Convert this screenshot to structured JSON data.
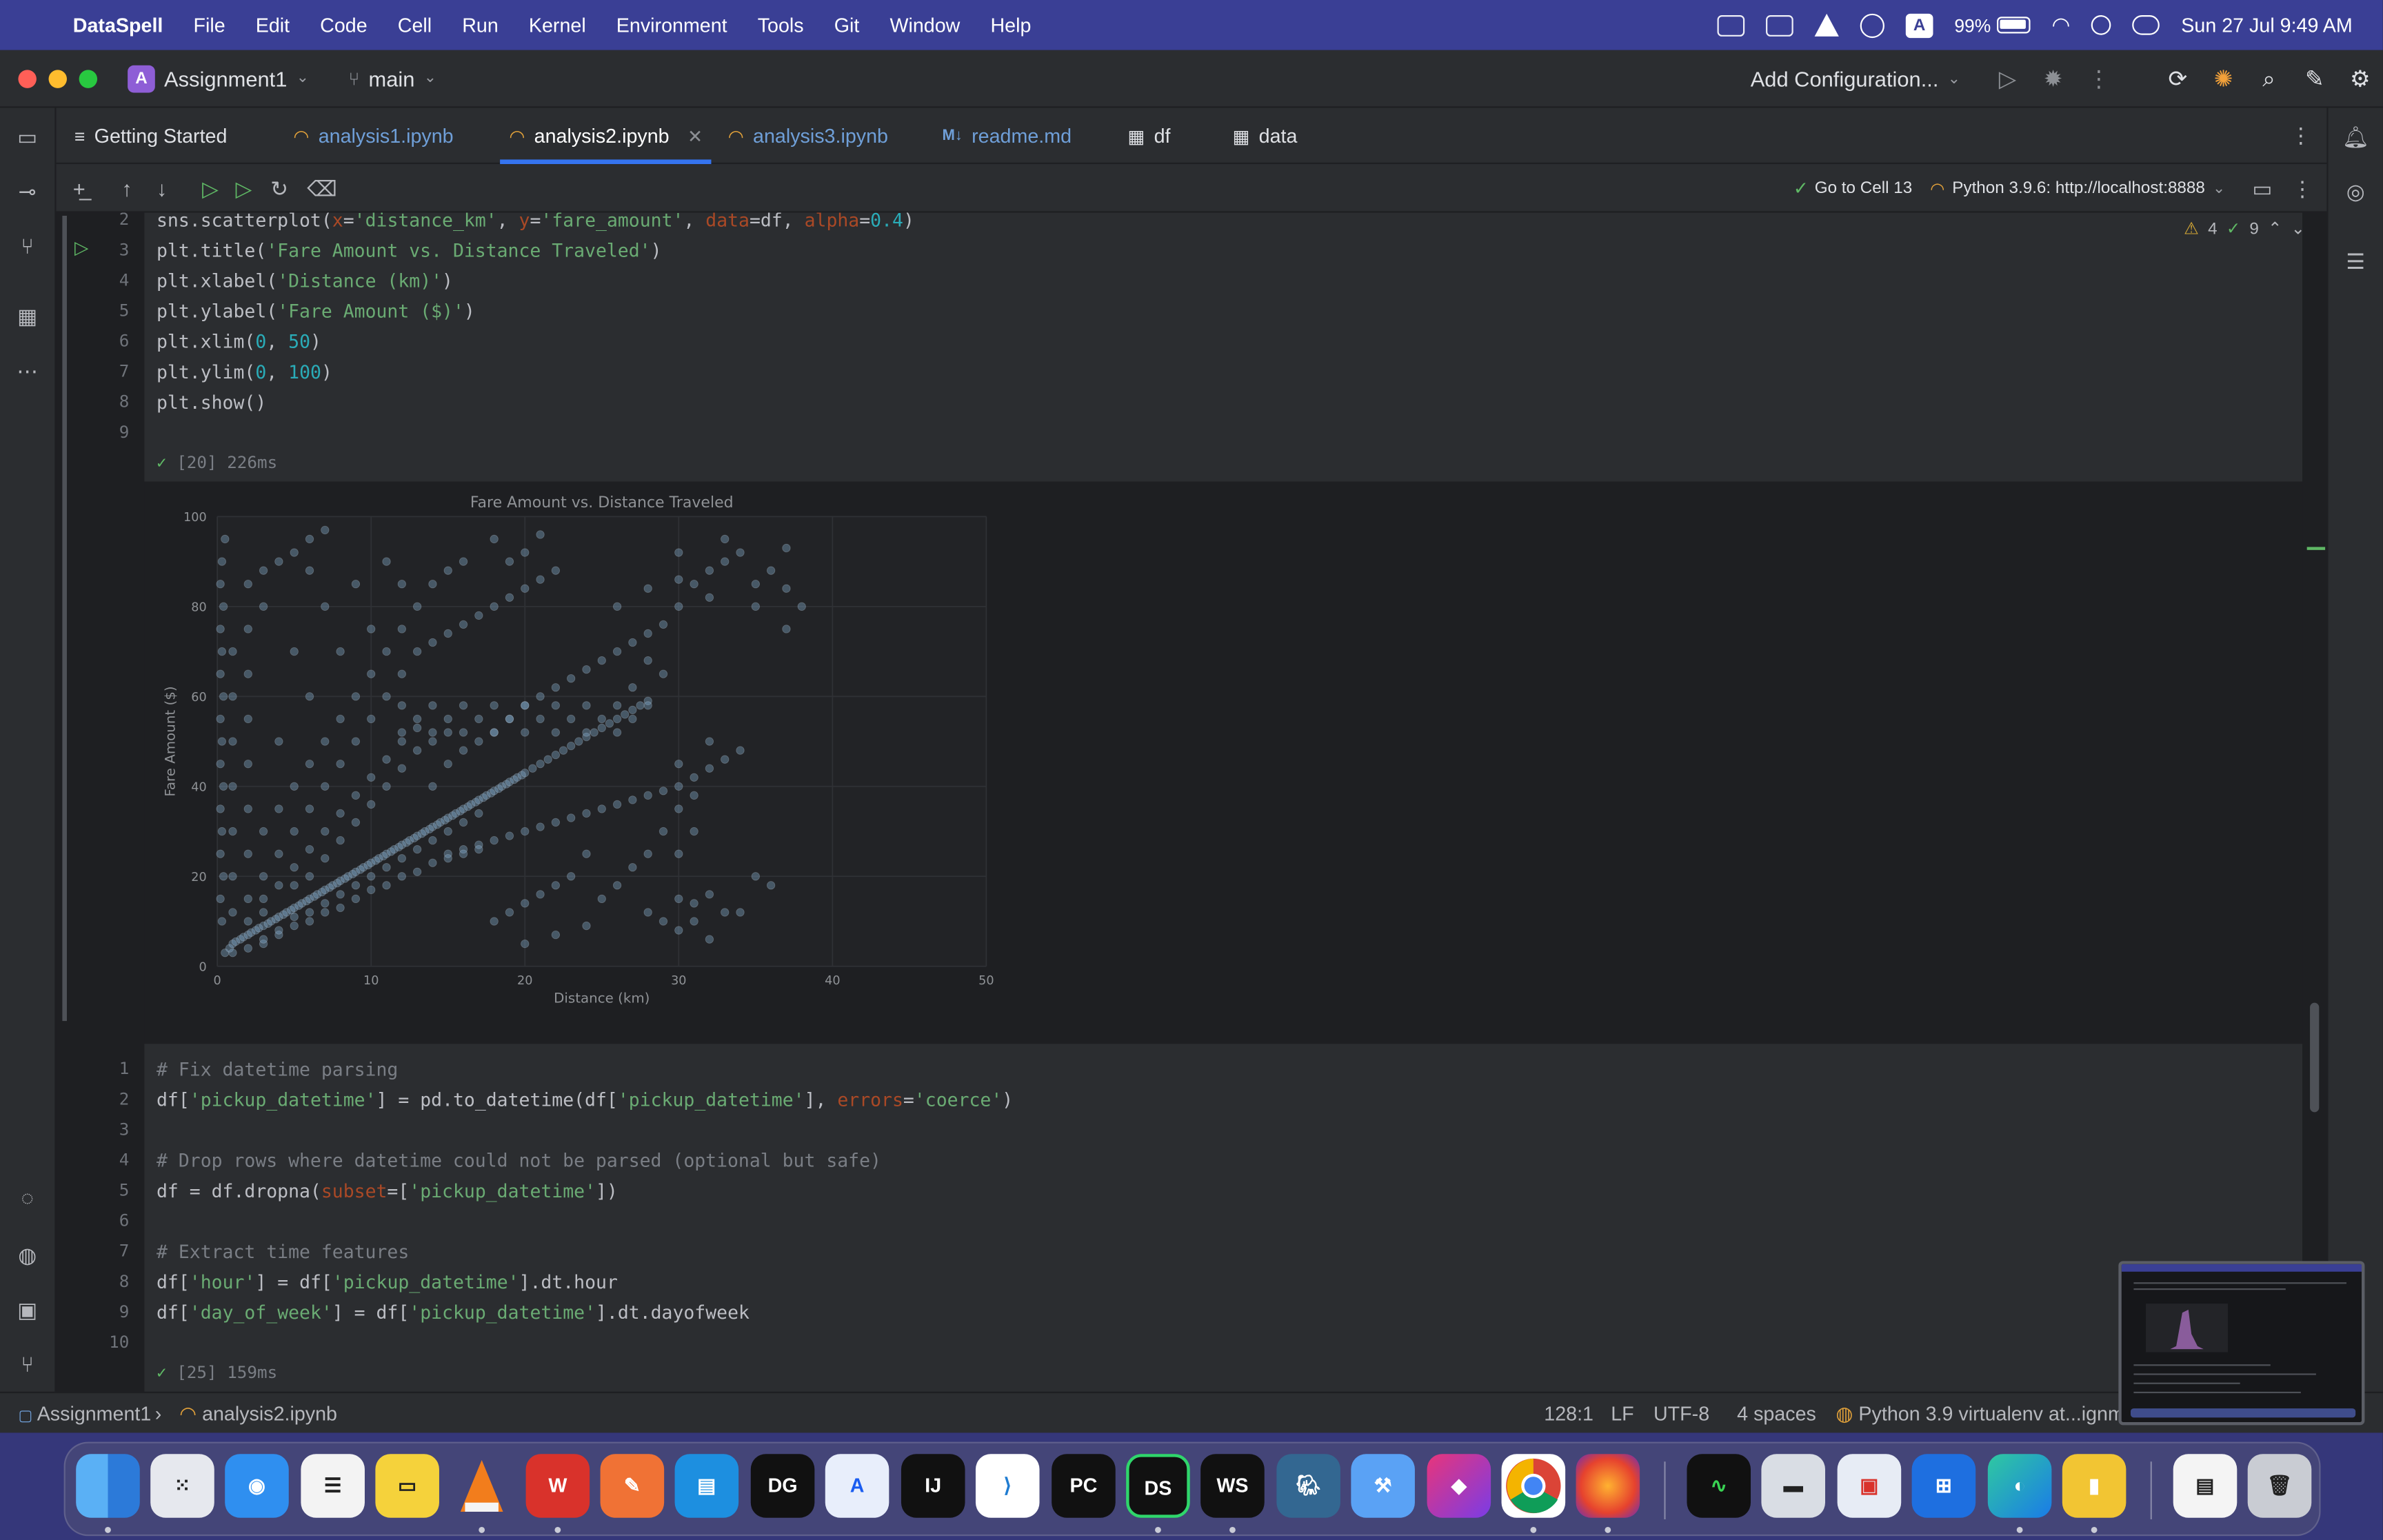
{
  "menubar": {
    "app": "DataSpell",
    "menus": [
      "File",
      "Edit",
      "Code",
      "Cell",
      "Run",
      "Kernel",
      "Environment",
      "Tools",
      "Git",
      "Window",
      "Help"
    ],
    "battery": "99%",
    "clock": "Sun 27 Jul  9:49 AM",
    "status_icons": [
      "display-icon",
      "w-icon",
      "vlc-icon",
      "play-icon",
      "a-icon",
      "battery-icon",
      "wifi-icon",
      "search-icon",
      "control-center-icon"
    ],
    "accent_color": "#3a3f95"
  },
  "titlebar": {
    "project_badge": "A",
    "project": "Assignment1",
    "branch": "main",
    "add_configuration": "Add Configuration..."
  },
  "tabs": [
    {
      "label": "Getting Started",
      "kind": "doc"
    },
    {
      "label": "analysis1.ipynb",
      "kind": "notebook"
    },
    {
      "label": "analysis2.ipynb",
      "kind": "notebook",
      "active": true
    },
    {
      "label": "analysis3.ipynb",
      "kind": "notebook"
    },
    {
      "label": "readme.md",
      "kind": "markdown",
      "icon": "M↓"
    },
    {
      "label": "df",
      "kind": "table"
    },
    {
      "label": "data",
      "kind": "table"
    }
  ],
  "toolbar": {
    "go_to_cell": "Go to Cell 13",
    "kernel": "Python 3.9.6: http://localhost:8888"
  },
  "inspections": {
    "warnings": "4",
    "ok": "9"
  },
  "cell1": {
    "lines": [
      {
        "num": "2"
      },
      {
        "num": "3"
      },
      {
        "num": "4"
      },
      {
        "num": "5"
      },
      {
        "num": "6"
      },
      {
        "num": "7"
      },
      {
        "num": "8"
      },
      {
        "num": "9"
      }
    ],
    "exec": "[20] 226ms"
  },
  "cell2": {
    "lines": [
      {
        "num": "1"
      },
      {
        "num": "2"
      },
      {
        "num": "3"
      },
      {
        "num": "4"
      },
      {
        "num": "5"
      },
      {
        "num": "6"
      },
      {
        "num": "7"
      },
      {
        "num": "8"
      },
      {
        "num": "9"
      },
      {
        "num": "10"
      }
    ],
    "exec": "[25] 159ms"
  },
  "statusbar": {
    "project": "Assignment1",
    "file": "analysis2.ipynb",
    "position": "128:1",
    "line_sep": "LF",
    "encoding": "UTF-8",
    "indent": "4 spaces",
    "interpreter": "Python 3.9 virtualenv at...ignm"
  },
  "chart_data": {
    "type": "scatter",
    "title": "Fare Amount vs. Distance Traveled",
    "xlabel": "Distance (km)",
    "ylabel": "Fare Amount ($)",
    "xlim": [
      0,
      50
    ],
    "ylim": [
      0,
      100
    ],
    "xticks": [
      "0",
      "10",
      "20",
      "30",
      "40",
      "50"
    ],
    "yticks": [
      "0",
      "20",
      "40",
      "60",
      "80",
      "100"
    ],
    "grid": true,
    "point_color": "#7fa7c9",
    "alpha": 0.4,
    "points": [
      [
        0.5,
        3
      ],
      [
        0.8,
        4
      ],
      [
        1,
        5
      ],
      [
        1.2,
        5.5
      ],
      [
        1.5,
        6
      ],
      [
        1.7,
        6.5
      ],
      [
        2,
        7
      ],
      [
        2.2,
        7.5
      ],
      [
        2.5,
        8
      ],
      [
        2.7,
        8.5
      ],
      [
        3,
        9
      ],
      [
        3.3,
        9.5
      ],
      [
        3.5,
        10
      ],
      [
        3.8,
        10.5
      ],
      [
        4,
        11
      ],
      [
        4.3,
        11.5
      ],
      [
        4.5,
        12
      ],
      [
        4.8,
        12.5
      ],
      [
        5,
        13
      ],
      [
        5.3,
        13.5
      ],
      [
        5.5,
        14
      ],
      [
        5.8,
        14.5
      ],
      [
        6,
        15
      ],
      [
        6.3,
        15.5
      ],
      [
        6.5,
        16
      ],
      [
        6.8,
        16.5
      ],
      [
        7,
        17
      ],
      [
        7.3,
        17.5
      ],
      [
        7.5,
        18
      ],
      [
        7.8,
        18.5
      ],
      [
        8,
        19
      ],
      [
        8.3,
        19.5
      ],
      [
        8.5,
        20
      ],
      [
        8.8,
        20.5
      ],
      [
        9,
        21
      ],
      [
        9.3,
        21.5
      ],
      [
        9.5,
        22
      ],
      [
        9.8,
        22.5
      ],
      [
        10,
        23
      ],
      [
        10.3,
        23.5
      ],
      [
        10.5,
        24
      ],
      [
        10.8,
        24.5
      ],
      [
        11,
        25
      ],
      [
        11.3,
        25.5
      ],
      [
        11.5,
        26
      ],
      [
        11.8,
        26.5
      ],
      [
        12,
        27
      ],
      [
        12.3,
        27.5
      ],
      [
        12.5,
        28
      ],
      [
        12.8,
        28.5
      ],
      [
        13,
        29
      ],
      [
        13.3,
        29.5
      ],
      [
        13.5,
        30
      ],
      [
        13.8,
        30.5
      ],
      [
        14,
        31
      ],
      [
        14.3,
        31.5
      ],
      [
        14.5,
        32
      ],
      [
        14.8,
        32.5
      ],
      [
        15,
        33
      ],
      [
        15.3,
        33.5
      ],
      [
        15.5,
        34
      ],
      [
        15.8,
        34.5
      ],
      [
        16,
        35
      ],
      [
        16.3,
        35.5
      ],
      [
        16.5,
        36
      ],
      [
        16.8,
        36.5
      ],
      [
        17,
        37
      ],
      [
        17.3,
        37.5
      ],
      [
        17.5,
        38
      ],
      [
        17.8,
        38.5
      ],
      [
        18,
        39
      ],
      [
        18.3,
        39.5
      ],
      [
        18.5,
        40
      ],
      [
        18.8,
        40.5
      ],
      [
        19,
        41
      ],
      [
        19.3,
        41.5
      ],
      [
        19.5,
        42
      ],
      [
        19.8,
        42.5
      ],
      [
        20,
        43
      ],
      [
        20.5,
        44
      ],
      [
        21,
        45
      ],
      [
        21.5,
        46
      ],
      [
        22,
        47
      ],
      [
        22.5,
        48
      ],
      [
        23,
        49
      ],
      [
        23.5,
        50
      ],
      [
        24,
        51
      ],
      [
        24.5,
        52
      ],
      [
        25,
        53
      ],
      [
        25.5,
        54
      ],
      [
        26,
        55
      ],
      [
        26.5,
        56
      ],
      [
        27,
        57
      ],
      [
        27.5,
        58
      ],
      [
        28,
        59
      ],
      [
        0.3,
        10
      ],
      [
        0.4,
        20
      ],
      [
        0.3,
        30
      ],
      [
        0.4,
        40
      ],
      [
        0.3,
        50
      ],
      [
        0.4,
        60
      ],
      [
        0.3,
        70
      ],
      [
        0.4,
        80
      ],
      [
        0.3,
        90
      ],
      [
        0.5,
        95
      ],
      [
        0.2,
        15
      ],
      [
        0.2,
        25
      ],
      [
        0.2,
        35
      ],
      [
        0.2,
        45
      ],
      [
        0.2,
        55
      ],
      [
        0.2,
        65
      ],
      [
        0.2,
        75
      ],
      [
        0.2,
        85
      ],
      [
        2,
        15
      ],
      [
        3,
        20
      ],
      [
        4,
        25
      ],
      [
        5,
        30
      ],
      [
        6,
        35
      ],
      [
        7,
        40
      ],
      [
        8,
        45
      ],
      [
        9,
        50
      ],
      [
        10,
        55
      ],
      [
        11,
        60
      ],
      [
        12,
        65
      ],
      [
        13,
        70
      ],
      [
        14,
        72
      ],
      [
        15,
        74
      ],
      [
        16,
        76
      ],
      [
        17,
        78
      ],
      [
        18,
        80
      ],
      [
        19,
        82
      ],
      [
        20,
        84
      ],
      [
        21,
        86
      ],
      [
        22,
        88
      ],
      [
        19,
        90
      ],
      [
        20,
        92
      ],
      [
        18,
        95
      ],
      [
        21,
        96
      ],
      [
        3,
        30
      ],
      [
        4,
        35
      ],
      [
        5,
        40
      ],
      [
        6,
        45
      ],
      [
        7,
        50
      ],
      [
        8,
        55
      ],
      [
        9,
        60
      ],
      [
        10,
        65
      ],
      [
        11,
        70
      ],
      [
        12,
        75
      ],
      [
        13,
        80
      ],
      [
        14,
        85
      ],
      [
        15,
        88
      ],
      [
        16,
        90
      ],
      [
        4,
        50
      ],
      [
        6,
        60
      ],
      [
        8,
        70
      ],
      [
        10,
        75
      ],
      [
        12,
        85
      ],
      [
        5,
        70
      ],
      [
        7,
        80
      ],
      [
        9,
        85
      ],
      [
        11,
        90
      ],
      [
        6,
        88
      ],
      [
        14,
        40
      ],
      [
        15,
        45
      ],
      [
        16,
        48
      ],
      [
        17,
        50
      ],
      [
        18,
        52
      ],
      [
        19,
        55
      ],
      [
        20,
        58
      ],
      [
        21,
        60
      ],
      [
        22,
        62
      ],
      [
        23,
        64
      ],
      [
        24,
        66
      ],
      [
        25,
        68
      ],
      [
        26,
        70
      ],
      [
        27,
        72
      ],
      [
        28,
        74
      ],
      [
        29,
        76
      ],
      [
        30,
        80
      ],
      [
        31,
        85
      ],
      [
        32,
        88
      ],
      [
        33,
        90
      ],
      [
        34,
        92
      ],
      [
        35,
        85
      ],
      [
        36,
        88
      ],
      [
        37,
        84
      ],
      [
        26,
        80
      ],
      [
        28,
        84
      ],
      [
        30,
        86
      ],
      [
        32,
        82
      ],
      [
        12,
        58
      ],
      [
        14,
        58
      ],
      [
        16,
        58
      ],
      [
        18,
        58
      ],
      [
        20,
        58
      ],
      [
        22,
        58
      ],
      [
        24,
        58
      ],
      [
        26,
        58
      ],
      [
        28,
        58
      ],
      [
        13,
        55
      ],
      [
        15,
        55
      ],
      [
        17,
        55
      ],
      [
        19,
        55
      ],
      [
        21,
        55
      ],
      [
        23,
        55
      ],
      [
        25,
        55
      ],
      [
        27,
        55
      ],
      [
        12,
        52
      ],
      [
        14,
        52
      ],
      [
        16,
        52
      ],
      [
        18,
        52
      ],
      [
        20,
        52
      ],
      [
        22,
        52
      ],
      [
        24,
        52
      ],
      [
        26,
        52
      ],
      [
        15,
        25
      ],
      [
        16,
        26
      ],
      [
        17,
        27
      ],
      [
        18,
        28
      ],
      [
        19,
        29
      ],
      [
        20,
        30
      ],
      [
        21,
        31
      ],
      [
        22,
        32
      ],
      [
        23,
        33
      ],
      [
        24,
        34
      ],
      [
        25,
        35
      ],
      [
        26,
        36
      ],
      [
        27,
        37
      ],
      [
        28,
        38
      ],
      [
        29,
        39
      ],
      [
        30,
        40
      ],
      [
        31,
        42
      ],
      [
        32,
        44
      ],
      [
        33,
        46
      ],
      [
        34,
        48
      ],
      [
        18,
        10
      ],
      [
        19,
        12
      ],
      [
        20,
        14
      ],
      [
        21,
        16
      ],
      [
        22,
        18
      ],
      [
        23,
        20
      ],
      [
        20,
        5
      ],
      [
        22,
        7
      ],
      [
        24,
        9
      ],
      [
        25,
        15
      ],
      [
        26,
        18
      ],
      [
        27,
        22
      ],
      [
        24,
        25
      ],
      [
        28,
        25
      ],
      [
        29,
        30
      ],
      [
        30,
        35
      ],
      [
        31,
        38
      ],
      [
        30,
        15
      ],
      [
        31,
        14
      ],
      [
        32,
        16
      ],
      [
        30,
        25
      ],
      [
        35,
        20
      ],
      [
        33,
        12
      ],
      [
        31,
        10
      ],
      [
        30,
        8
      ],
      [
        32,
        6
      ],
      [
        34,
        12
      ],
      [
        36,
        18
      ],
      [
        28,
        12
      ],
      [
        29,
        10
      ],
      [
        37,
        75
      ],
      [
        38,
        80
      ],
      [
        33,
        95
      ],
      [
        30,
        92
      ],
      [
        37,
        93
      ],
      [
        35,
        80
      ],
      [
        31,
        30
      ],
      [
        30,
        45
      ],
      [
        32,
        50
      ],
      [
        28,
        68
      ],
      [
        29,
        65
      ],
      [
        27,
        62
      ],
      [
        3,
        5
      ],
      [
        4,
        7
      ],
      [
        5,
        9
      ],
      [
        6,
        10
      ],
      [
        7,
        12
      ],
      [
        8,
        13
      ],
      [
        9,
        15
      ],
      [
        10,
        17
      ],
      [
        11,
        18
      ],
      [
        12,
        20
      ],
      [
        13,
        21
      ],
      [
        14,
        23
      ],
      [
        15,
        24
      ],
      [
        16,
        25
      ],
      [
        17,
        26
      ],
      [
        1,
        3
      ],
      [
        2,
        4
      ],
      [
        3,
        6
      ],
      [
        4,
        8
      ],
      [
        5,
        11
      ],
      [
        6,
        12
      ],
      [
        7,
        14
      ],
      [
        8,
        16
      ],
      [
        9,
        18
      ],
      [
        10,
        20
      ],
      [
        11,
        22
      ],
      [
        12,
        24
      ],
      [
        13,
        26
      ],
      [
        14,
        28
      ],
      [
        15,
        30
      ],
      [
        16,
        32
      ],
      [
        17,
        34
      ],
      [
        3,
        15
      ],
      [
        4,
        18
      ],
      [
        5,
        22
      ],
      [
        6,
        26
      ],
      [
        7,
        30
      ],
      [
        8,
        34
      ],
      [
        9,
        38
      ],
      [
        10,
        42
      ],
      [
        11,
        46
      ],
      [
        12,
        50
      ],
      [
        13,
        53
      ],
      [
        2,
        10
      ],
      [
        3,
        12
      ],
      [
        5,
        18
      ],
      [
        6,
        20
      ],
      [
        7,
        24
      ],
      [
        8,
        28
      ],
      [
        9,
        32
      ],
      [
        10,
        36
      ],
      [
        11,
        40
      ],
      [
        12,
        44
      ],
      [
        13,
        48
      ],
      [
        14,
        50
      ],
      [
        15,
        52
      ],
      [
        1,
        12
      ],
      [
        1,
        20
      ],
      [
        2,
        25
      ],
      [
        1,
        30
      ],
      [
        2,
        35
      ],
      [
        1,
        40
      ],
      [
        2,
        45
      ],
      [
        1,
        50
      ],
      [
        2,
        55
      ],
      [
        1,
        60
      ],
      [
        2,
        65
      ],
      [
        1,
        70
      ],
      [
        2,
        75
      ],
      [
        3,
        80
      ],
      [
        2,
        85
      ],
      [
        3,
        88
      ],
      [
        4,
        90
      ],
      [
        5,
        92
      ],
      [
        6,
        95
      ],
      [
        7,
        97
      ]
    ]
  }
}
